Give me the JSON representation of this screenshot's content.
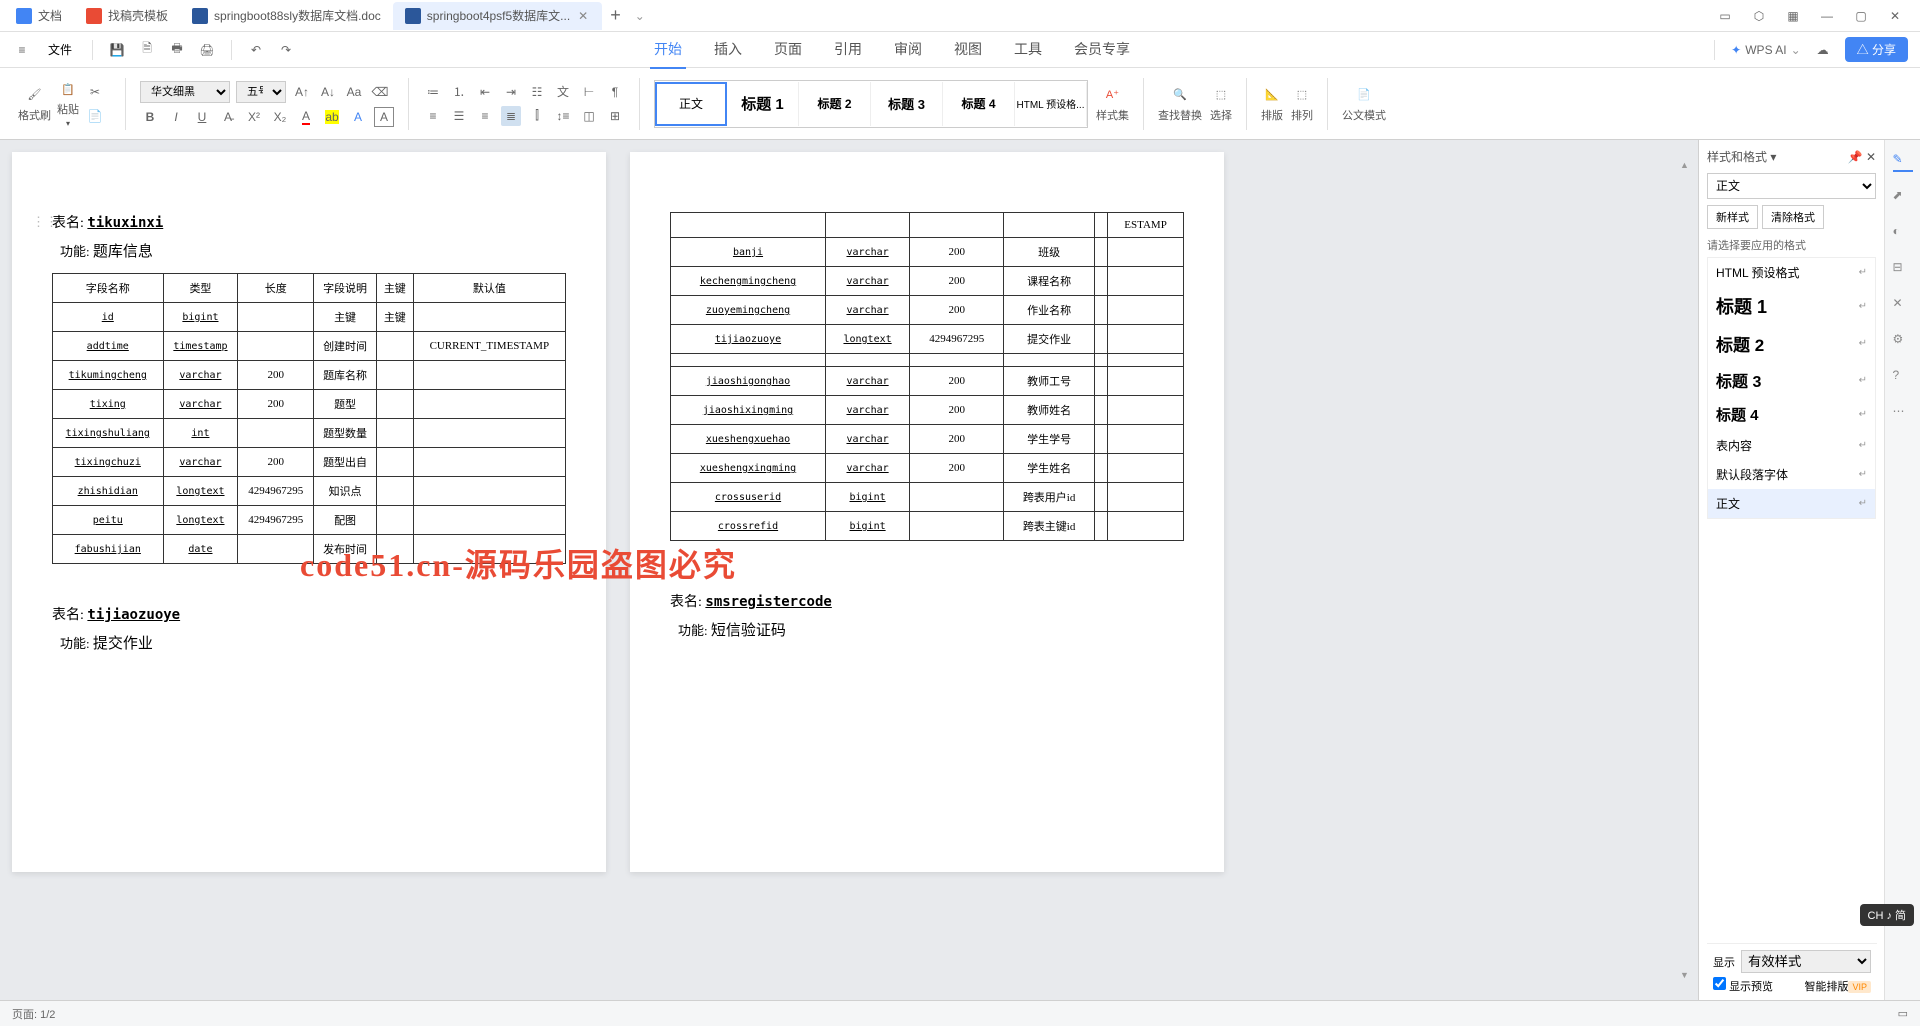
{
  "tabs": [
    {
      "label": "文档",
      "icon": "blue"
    },
    {
      "label": "找稿壳模板",
      "icon": "red"
    },
    {
      "label": "springboot88sly数据库文档.doc",
      "icon": "word"
    },
    {
      "label": "springboot4psf5数据库文...",
      "icon": "word",
      "active": true
    }
  ],
  "file_menu": "文件",
  "menu": {
    "items": [
      "开始",
      "插入",
      "页面",
      "引用",
      "审阅",
      "视图",
      "工具",
      "会员专享"
    ],
    "active": "开始",
    "wps_ai": "WPS AI",
    "share": "分享"
  },
  "ribbon": {
    "format_painter": "格式刷",
    "paste": "粘贴",
    "font_name": "华文细黑",
    "font_size": "五号",
    "style_set": "样式集",
    "find_replace": "查找替换",
    "select": "选择",
    "layout": "排版",
    "arrange": "排列",
    "doc_mode": "公文模式",
    "styles": [
      "正文",
      "标题 1",
      "标题 2",
      "标题 3",
      "标题 4",
      "HTML 预设格..."
    ],
    "active_style": "正文"
  },
  "panel": {
    "title": "样式和格式",
    "current": "正文",
    "new_style": "新样式",
    "clear_format": "清除格式",
    "apply_label": "请选择要应用的格式",
    "styles": [
      {
        "name": "HTML 预设格式",
        "cls": ""
      },
      {
        "name": "标题 1",
        "cls": "h1s"
      },
      {
        "name": "标题 2",
        "cls": "h2s"
      },
      {
        "name": "标题 3",
        "cls": "h3s"
      },
      {
        "name": "标题 4",
        "cls": "h4s"
      },
      {
        "name": "表内容",
        "cls": ""
      },
      {
        "name": "默认段落字体",
        "cls": ""
      },
      {
        "name": "正文",
        "cls": "",
        "selected": true
      }
    ],
    "show_label": "显示",
    "show_value": "有效样式",
    "preview_check": "显示预览",
    "smart_layout": "智能排版"
  },
  "document": {
    "page1": {
      "table_label": "表名:",
      "table_name": "tikuxinxi",
      "func_label": "功能:",
      "func_name": "题库信息",
      "headers": [
        "字段名称",
        "类型",
        "长度",
        "字段说明",
        "主键",
        "默认值"
      ],
      "rows": [
        [
          "id",
          "bigint",
          "",
          "主键",
          "主键",
          ""
        ],
        [
          "addtime",
          "timestamp",
          "",
          "创建时间",
          "",
          "CURRENT_TIMESTAMP"
        ],
        [
          "tikumingcheng",
          "varchar",
          "200",
          "题库名称",
          "",
          ""
        ],
        [
          "tixing",
          "varchar",
          "200",
          "题型",
          "",
          ""
        ],
        [
          "tixingshuliang",
          "int",
          "",
          "题型数量",
          "",
          ""
        ],
        [
          "tixingchuzi",
          "varchar",
          "200",
          "题型出自",
          "",
          ""
        ],
        [
          "zhishidian",
          "longtext",
          "4294967295",
          "知识点",
          "",
          ""
        ],
        [
          "peitu",
          "longtext",
          "4294967295",
          "配图",
          "",
          ""
        ],
        [
          "fabushijian",
          "date",
          "",
          "发布时间",
          "",
          ""
        ]
      ],
      "table2_label": "表名:",
      "table2_name": "tijiaozuoye",
      "func2_label": "功能:",
      "func2_name": "提交作业"
    },
    "page2": {
      "top_cell": "ESTAMP",
      "rows": [
        [
          "banji",
          "varchar",
          "200",
          "班级",
          "",
          ""
        ],
        [
          "kechengmingcheng",
          "varchar",
          "200",
          "课程名称",
          "",
          ""
        ],
        [
          "zuoyemingcheng",
          "varchar",
          "200",
          "作业名称",
          "",
          ""
        ],
        [
          "tijiaozuoye",
          "longtext",
          "4294967295",
          "提交作业",
          "",
          ""
        ],
        [
          "",
          "",
          "",
          "",
          "",
          ""
        ],
        [
          "jiaoshigonghao",
          "varchar",
          "200",
          "教师工号",
          "",
          ""
        ],
        [
          "jiaoshixingming",
          "varchar",
          "200",
          "教师姓名",
          "",
          ""
        ],
        [
          "xueshengxuehao",
          "varchar",
          "200",
          "学生学号",
          "",
          ""
        ],
        [
          "xueshengxingming",
          "varchar",
          "200",
          "学生姓名",
          "",
          ""
        ],
        [
          "crossuserid",
          "bigint",
          "",
          "跨表用户id",
          "",
          ""
        ],
        [
          "crossrefid",
          "bigint",
          "",
          "跨表主键id",
          "",
          ""
        ]
      ],
      "table3_label": "表名:",
      "table3_name": "smsregistercode",
      "func3_label": "功能:",
      "func3_name": "短信验证码"
    }
  },
  "watermark": "code51.cn-源码乐园盗图必究",
  "ime": "CH ♪ 简",
  "status": {
    "page": "页面: 1/2"
  }
}
